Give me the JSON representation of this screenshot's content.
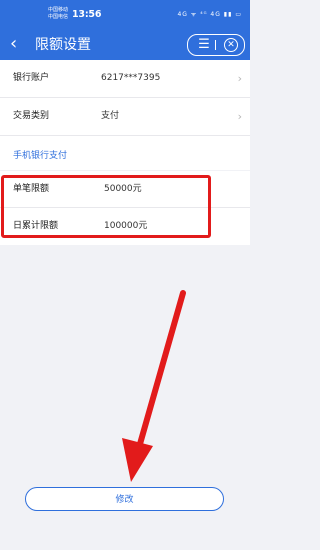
{
  "status_bar": {
    "carrier_1": "中国移动",
    "carrier_2": "中国电信",
    "time": "13:56",
    "icons": "4G ᯤ ⁴ᴳ 4G ▮▮ ▭"
  },
  "nav": {
    "title": "限额设置",
    "back_icon": "chevron-left-icon",
    "menu_icon": "menu-icon",
    "close_icon": "close-circle-icon"
  },
  "rows": [
    {
      "label": "银行账户",
      "value": "6217***7395"
    },
    {
      "label": "交易类别",
      "value": "支付"
    }
  ],
  "section_heading": "手机银行支付",
  "limits": [
    {
      "label": "单笔限额",
      "value": "50000元"
    },
    {
      "label": "日累计限额",
      "value": "100000元"
    }
  ],
  "modify_button": "修改",
  "colors": {
    "primary": "#2f6fdc",
    "annotation_red": "#e21b1b",
    "background": "#f1f2f6"
  }
}
